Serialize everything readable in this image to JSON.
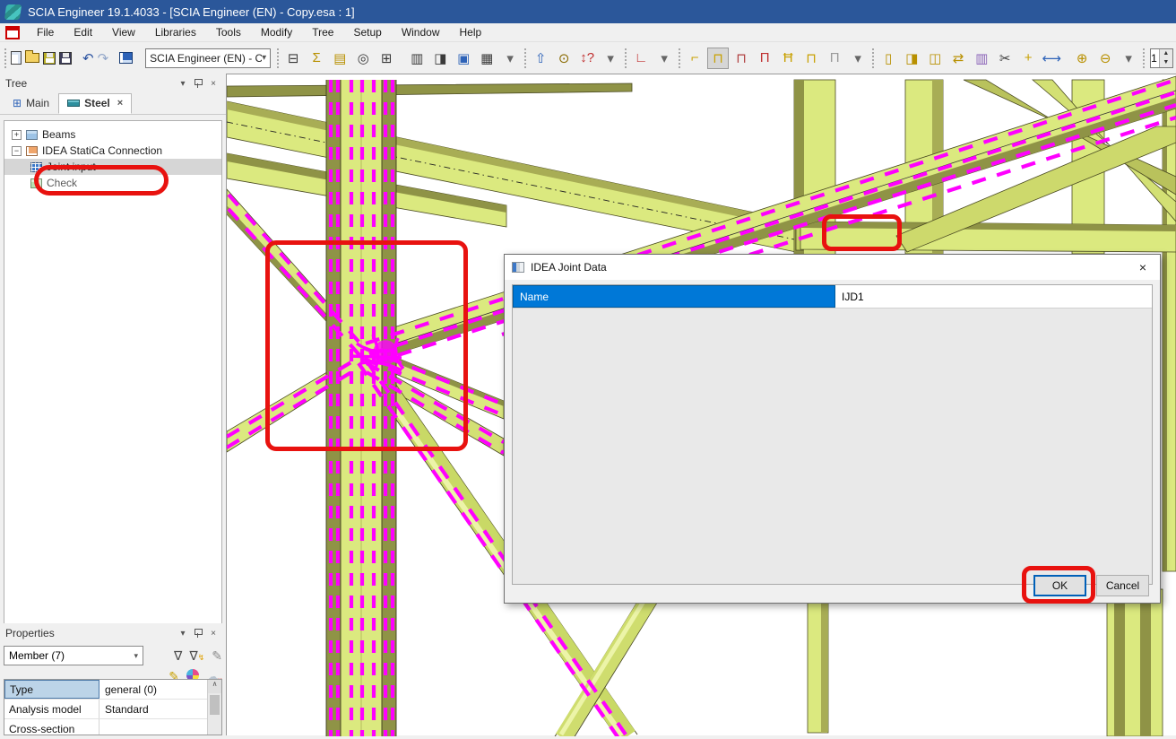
{
  "window": {
    "title": "SCIA Engineer 19.1.4033 - [SCIA Engineer (EN) - Copy.esa : 1]"
  },
  "menu": {
    "items": [
      "File",
      "Edit",
      "View",
      "Libraries",
      "Tools",
      "Modify",
      "Tree",
      "Setup",
      "Window",
      "Help"
    ]
  },
  "toolbar": {
    "combo_value": "SCIA Engineer (EN) - Cop",
    "combo_arrow": "▾",
    "spinner_value": "1",
    "undo_glyph": "↶",
    "redo_glyph": "↷",
    "groups": {
      "clipboard": [
        {
          "name": "layers-icon",
          "glyph": "⊟",
          "color": "#3a3a3a"
        },
        {
          "name": "sum-icon",
          "glyph": "Σ",
          "color": "#b89000"
        },
        {
          "name": "paste-icon",
          "glyph": "▤",
          "color": "#b89000"
        },
        {
          "name": "target-icon",
          "glyph": "◎",
          "color": "#3a3a3a"
        },
        {
          "name": "table-icon",
          "glyph": "⊞",
          "color": "#3a3a3a"
        }
      ],
      "print": [
        {
          "name": "printer-icon",
          "glyph": "▥",
          "color": "#3a3a3a"
        },
        {
          "name": "print-preview-icon",
          "glyph": "◨",
          "color": "#3a3a3a"
        },
        {
          "name": "document-icon",
          "glyph": "▣",
          "color": "#2e63b8"
        },
        {
          "name": "gallery-icon",
          "glyph": "▦",
          "color": "#3a3a3a"
        },
        {
          "name": "overflow-arrow-icon",
          "glyph": "▾",
          "color": "#666"
        }
      ],
      "view": [
        {
          "name": "export-icon",
          "glyph": "⇧",
          "color": "#2e63b8"
        },
        {
          "name": "zoom-doc-icon",
          "glyph": "⊙",
          "color": "#8a6a00"
        },
        {
          "name": "dimension-icon",
          "glyph": "↕?",
          "color": "#c03030"
        },
        {
          "name": "overflow-arrow-icon",
          "glyph": "▾",
          "color": "#666"
        }
      ],
      "axes": [
        {
          "name": "ucs-axes-icon",
          "glyph": "∟",
          "color": "#c03030"
        },
        {
          "name": "overflow-arrow-icon",
          "glyph": "▾",
          "color": "#666"
        }
      ],
      "steel": [
        {
          "name": "haunch-icon",
          "glyph": "⌐",
          "color": "#c8a000"
        },
        {
          "name": "connection-icon",
          "glyph": "⊓",
          "color": "#c8a000",
          "active": true
        },
        {
          "name": "connection-grid-icon",
          "glyph": "⊓",
          "color": "#b04040"
        },
        {
          "name": "frame-red-icon",
          "glyph": "Π",
          "color": "#c03030"
        },
        {
          "name": "bolted-frame-icon",
          "glyph": "Ħ",
          "color": "#c8a000"
        },
        {
          "name": "frame-xy-icon",
          "glyph": "⊓",
          "color": "#c8a000"
        },
        {
          "name": "frame-grey-icon",
          "glyph": "Π",
          "color": "#9a9a9a"
        },
        {
          "name": "overflow-arrow-icon",
          "glyph": "▾",
          "color": "#666"
        }
      ],
      "modify": [
        {
          "name": "move-member-icon",
          "glyph": "▯",
          "color": "#b89000"
        },
        {
          "name": "copy-member-icon",
          "glyph": "◨",
          "color": "#b89000"
        },
        {
          "name": "mirror-member-icon",
          "glyph": "◫",
          "color": "#b89000"
        },
        {
          "name": "swap-member-icon",
          "glyph": "⇄",
          "color": "#b89000"
        },
        {
          "name": "stripe-member-icon",
          "glyph": "▥",
          "color": "#8a62b8"
        },
        {
          "name": "trim-icon",
          "glyph": "✂",
          "color": "#3a3a3a"
        },
        {
          "name": "intersect-icon",
          "glyph": "+",
          "color": "#c8a000"
        },
        {
          "name": "stretch-icon",
          "glyph": "⟷",
          "color": "#2e63b8"
        }
      ],
      "nodes": [
        {
          "name": "add-node-icon",
          "glyph": "⊕",
          "color": "#b89000"
        },
        {
          "name": "remove-node-icon",
          "glyph": "⊖",
          "color": "#b89000"
        },
        {
          "name": "overflow-arrow-icon",
          "glyph": "▾",
          "color": "#666"
        }
      ],
      "scale": [
        {
          "name": "scale-axes-icon",
          "glyph": "×",
          "color": "#c03030"
        }
      ]
    }
  },
  "tree_panel": {
    "title": "Tree",
    "collapse_glyph": "▾",
    "close_glyph": "×",
    "tabs": {
      "main": "Main",
      "steel": "Steel",
      "steel_close": "×",
      "main_icon": "⊞"
    },
    "items": {
      "beams": {
        "label": "Beams",
        "expander": "+"
      },
      "idea": {
        "label": "IDEA StatiCa Connection",
        "expander": "−"
      },
      "joint_input": {
        "label": "Joint input"
      },
      "check": {
        "label": "Check"
      }
    }
  },
  "properties_panel": {
    "title": "Properties",
    "collapse_glyph": "▾",
    "close_glyph": "×",
    "selector_value": "Member (7)",
    "selector_arrow": "▾",
    "icons": {
      "filter": "∇",
      "filter2": "∇",
      "feather": "✎",
      "brush": "✎"
    },
    "rows": {
      "type": {
        "label": "Type",
        "value": "general (0)",
        "arrow": "▾"
      },
      "analysis": {
        "label": "Analysis model",
        "value": "Standard",
        "arrow": "▾"
      },
      "partial": {
        "label": "Cross-section",
        "value": ""
      }
    },
    "scroll_up_glyph": "∧"
  },
  "dialog": {
    "title": "IDEA Joint Data",
    "close_glyph": "×",
    "name_field": {
      "label": "Name",
      "value": "IJD1"
    },
    "buttons": {
      "ok": "OK",
      "cancel": "Cancel"
    }
  },
  "colors": {
    "titlebar": "#2b579a",
    "beam_light": "#dbe97f",
    "beam_olive": "#8f9346",
    "selection_magenta": "#ff00ff",
    "annotation_red": "#e8120f",
    "accent_blue": "#0078d7"
  }
}
